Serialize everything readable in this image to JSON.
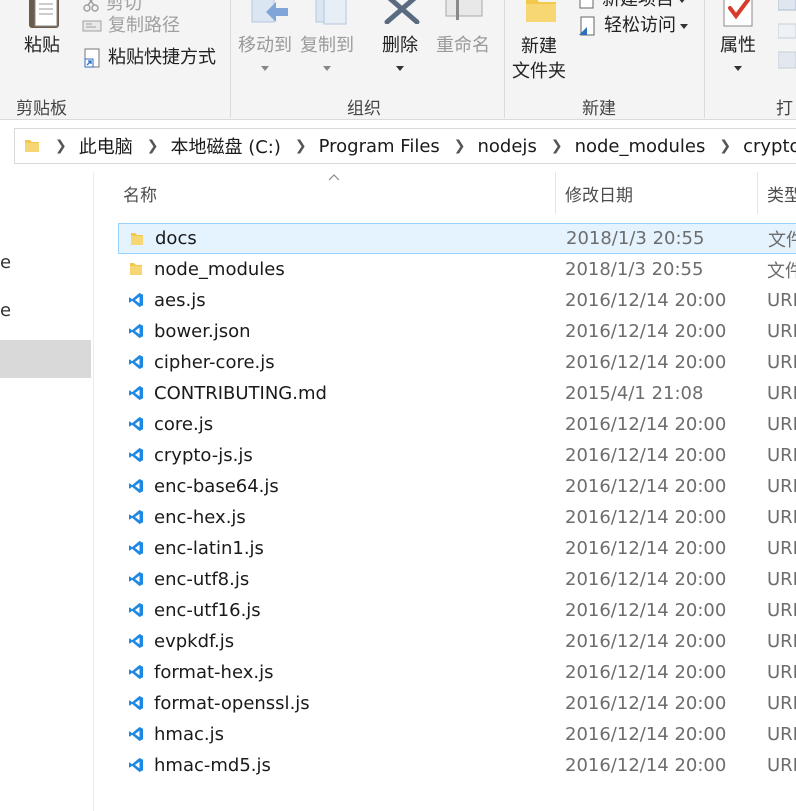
{
  "ribbon": {
    "clipboard": {
      "group_label": "剪贴板",
      "paste_label": "粘贴",
      "cut_label": "剪切",
      "copy_path_label": "复制路径",
      "paste_shortcut_label": "粘贴快捷方式"
    },
    "organize": {
      "group_label": "组织",
      "move_to_label": "移动到",
      "copy_to_label": "复制到",
      "delete_label": "删除",
      "rename_label": "重命名"
    },
    "new": {
      "group_label": "新建",
      "new_folder_label_line1": "新建",
      "new_folder_label_line2": "文件夹",
      "new_item_label": "新建项目",
      "easy_access_label": "轻松访问"
    },
    "open": {
      "properties_label": "属性",
      "group_label_partial": "打"
    }
  },
  "address": {
    "crumbs": [
      "此电脑",
      "本地磁盘 (C:)",
      "Program Files",
      "nodejs",
      "node_modules",
      "crypto-js"
    ]
  },
  "nav": {
    "fragments": [
      "e",
      "e"
    ]
  },
  "columns": {
    "name": "名称",
    "date": "修改日期",
    "type": "类型"
  },
  "files": [
    {
      "name": "docs",
      "date": "2018/1/3 20:55",
      "type": "文件夹",
      "icon": "folder-icon",
      "selected": true
    },
    {
      "name": "node_modules",
      "date": "2018/1/3 20:55",
      "type": "文件夹",
      "icon": "folder-icon"
    },
    {
      "name": "aes.js",
      "date": "2016/12/14 20:00",
      "type": "URL",
      "icon": "vscode-file-icon"
    },
    {
      "name": "bower.json",
      "date": "2016/12/14 20:00",
      "type": "URL",
      "icon": "vscode-file-icon"
    },
    {
      "name": "cipher-core.js",
      "date": "2016/12/14 20:00",
      "type": "URL",
      "icon": "vscode-file-icon"
    },
    {
      "name": "CONTRIBUTING.md",
      "date": "2015/4/1 21:08",
      "type": "URL",
      "icon": "vscode-file-icon"
    },
    {
      "name": "core.js",
      "date": "2016/12/14 20:00",
      "type": "URL",
      "icon": "vscode-file-icon"
    },
    {
      "name": "crypto-js.js",
      "date": "2016/12/14 20:00",
      "type": "URL",
      "icon": "vscode-file-icon"
    },
    {
      "name": "enc-base64.js",
      "date": "2016/12/14 20:00",
      "type": "URL",
      "icon": "vscode-file-icon"
    },
    {
      "name": "enc-hex.js",
      "date": "2016/12/14 20:00",
      "type": "URL",
      "icon": "vscode-file-icon"
    },
    {
      "name": "enc-latin1.js",
      "date": "2016/12/14 20:00",
      "type": "URL",
      "icon": "vscode-file-icon"
    },
    {
      "name": "enc-utf8.js",
      "date": "2016/12/14 20:00",
      "type": "URL",
      "icon": "vscode-file-icon"
    },
    {
      "name": "enc-utf16.js",
      "date": "2016/12/14 20:00",
      "type": "URL",
      "icon": "vscode-file-icon"
    },
    {
      "name": "evpkdf.js",
      "date": "2016/12/14 20:00",
      "type": "URL",
      "icon": "vscode-file-icon"
    },
    {
      "name": "format-hex.js",
      "date": "2016/12/14 20:00",
      "type": "URL",
      "icon": "vscode-file-icon"
    },
    {
      "name": "format-openssl.js",
      "date": "2016/12/14 20:00",
      "type": "URL",
      "icon": "vscode-file-icon"
    },
    {
      "name": "hmac.js",
      "date": "2016/12/14 20:00",
      "type": "URL",
      "icon": "vscode-file-icon"
    },
    {
      "name": "hmac-md5.js",
      "date": "2016/12/14 20:00",
      "type": "URL",
      "icon": "vscode-file-icon"
    }
  ],
  "colors": {
    "folder": "#f2c94c",
    "vscode_blue": "#1e88e5",
    "selection_bg": "#e5f3ff",
    "selection_border": "#99d1ff"
  }
}
